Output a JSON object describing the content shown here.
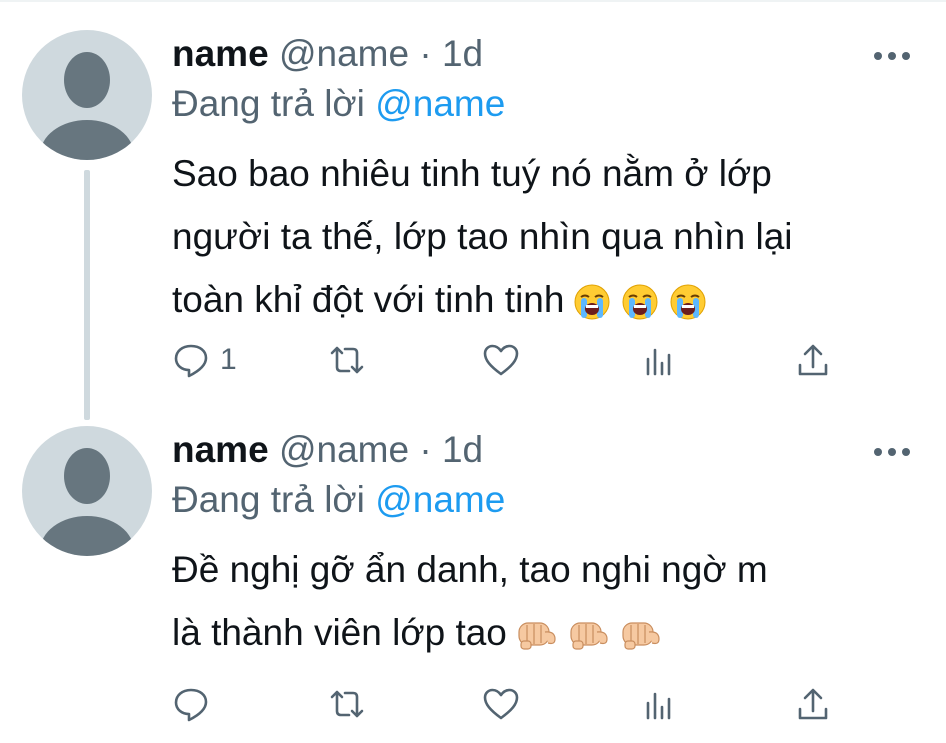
{
  "tweets": [
    {
      "display_name": "name",
      "handle": "@name",
      "separator": "·",
      "time": "1d",
      "reply_prefix": "Đang trả lời",
      "reply_mention": "@name",
      "text_lines": [
        "Sao bao nhiêu tinh tuý nó nằm ở lớp",
        "người ta thế, lớp tao nhìn qua nhìn lại",
        "toàn khỉ đột với tinh tinh"
      ],
      "emojis": [
        "loudly-crying-face",
        "loudly-crying-face",
        "loudly-crying-face"
      ],
      "reply_count": "1",
      "actions": [
        "reply-icon",
        "retweet-icon",
        "like-icon",
        "views-icon",
        "share-icon"
      ]
    },
    {
      "display_name": "name",
      "handle": "@name",
      "separator": "·",
      "time": "1d",
      "reply_prefix": "Đang trả lời",
      "reply_mention": "@name",
      "text_lines": [
        "Đề nghị gỡ ẩn danh, tao nghi ngờ m",
        "là thành viên lớp tao"
      ],
      "emojis": [
        "thumbs-down-hand",
        "thumbs-down-hand",
        "thumbs-down-hand"
      ],
      "reply_count": "",
      "actions": [
        "reply-icon",
        "retweet-icon",
        "like-icon",
        "views-icon",
        "share-icon"
      ]
    }
  ],
  "colors": {
    "text": "#0f1419",
    "secondary": "#536471",
    "link": "#1d9bf0",
    "avatar_bg": "#cfd9de",
    "avatar_fg": "#67767f",
    "thread_line": "#cfd9de"
  }
}
